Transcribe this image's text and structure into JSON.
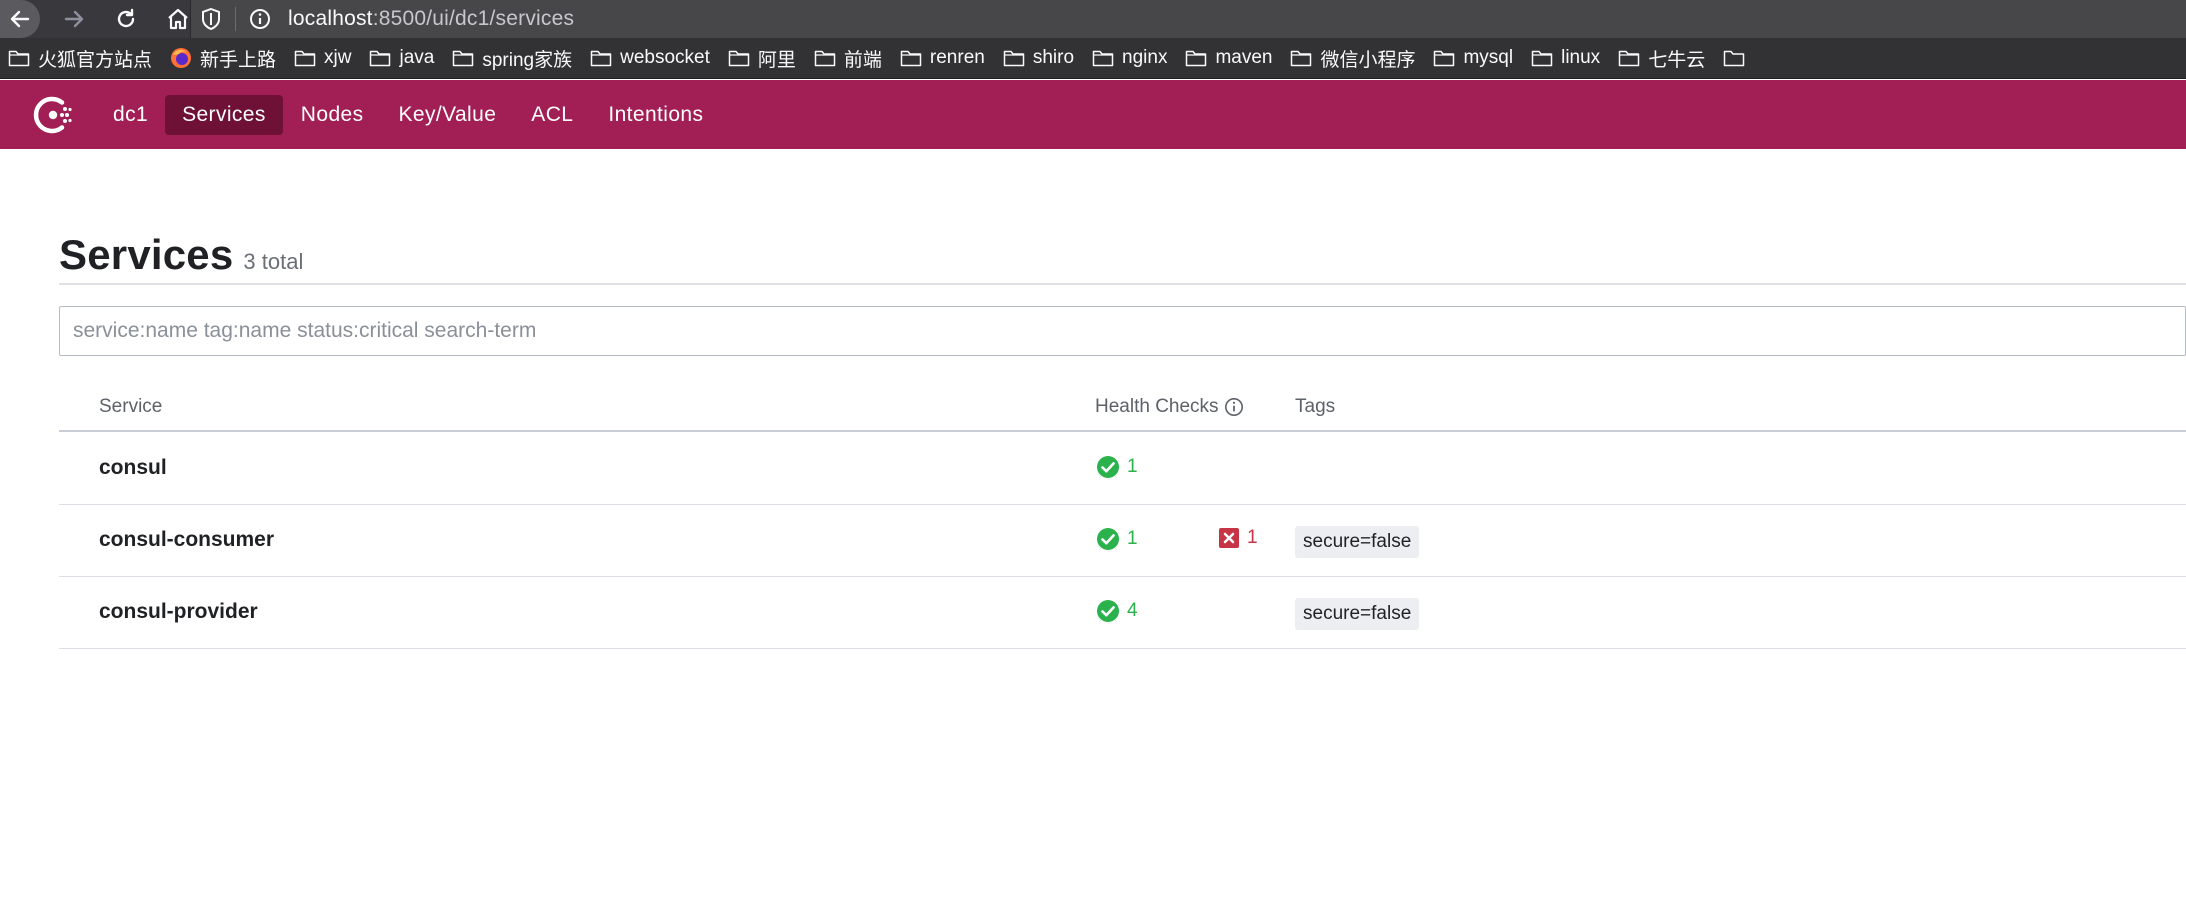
{
  "browser": {
    "url_host": "localhost",
    "url_path": ":8500/ui/dc1/services",
    "bookmarks": [
      "火狐官方站点",
      "新手上路",
      "xjw",
      "java",
      "spring家族",
      "websocket",
      "阿里",
      "前端",
      "renren",
      "shiro",
      "nginx",
      "maven",
      "微信小程序",
      "mysql",
      "linux",
      "七牛云"
    ]
  },
  "nav": {
    "datacenter": "dc1",
    "items": [
      "Services",
      "Nodes",
      "Key/Value",
      "ACL",
      "Intentions"
    ],
    "active": "Services"
  },
  "page": {
    "title": "Services",
    "total": "3 total",
    "search_placeholder": "service:name tag:name status:critical search-term"
  },
  "table": {
    "headers": {
      "service": "Service",
      "health": "Health Checks",
      "tags": "Tags"
    },
    "rows": [
      {
        "name": "consul",
        "passing": "1",
        "critical": "",
        "tag": ""
      },
      {
        "name": "consul-consumer",
        "passing": "1",
        "critical": "1",
        "tag": "secure=false"
      },
      {
        "name": "consul-provider",
        "passing": "4",
        "critical": "",
        "tag": "secure=false"
      }
    ]
  },
  "colors": {
    "brand": "#a21f55",
    "active_nav": "#6f1036",
    "passing": "#2bb24c",
    "critical": "#c73445"
  }
}
